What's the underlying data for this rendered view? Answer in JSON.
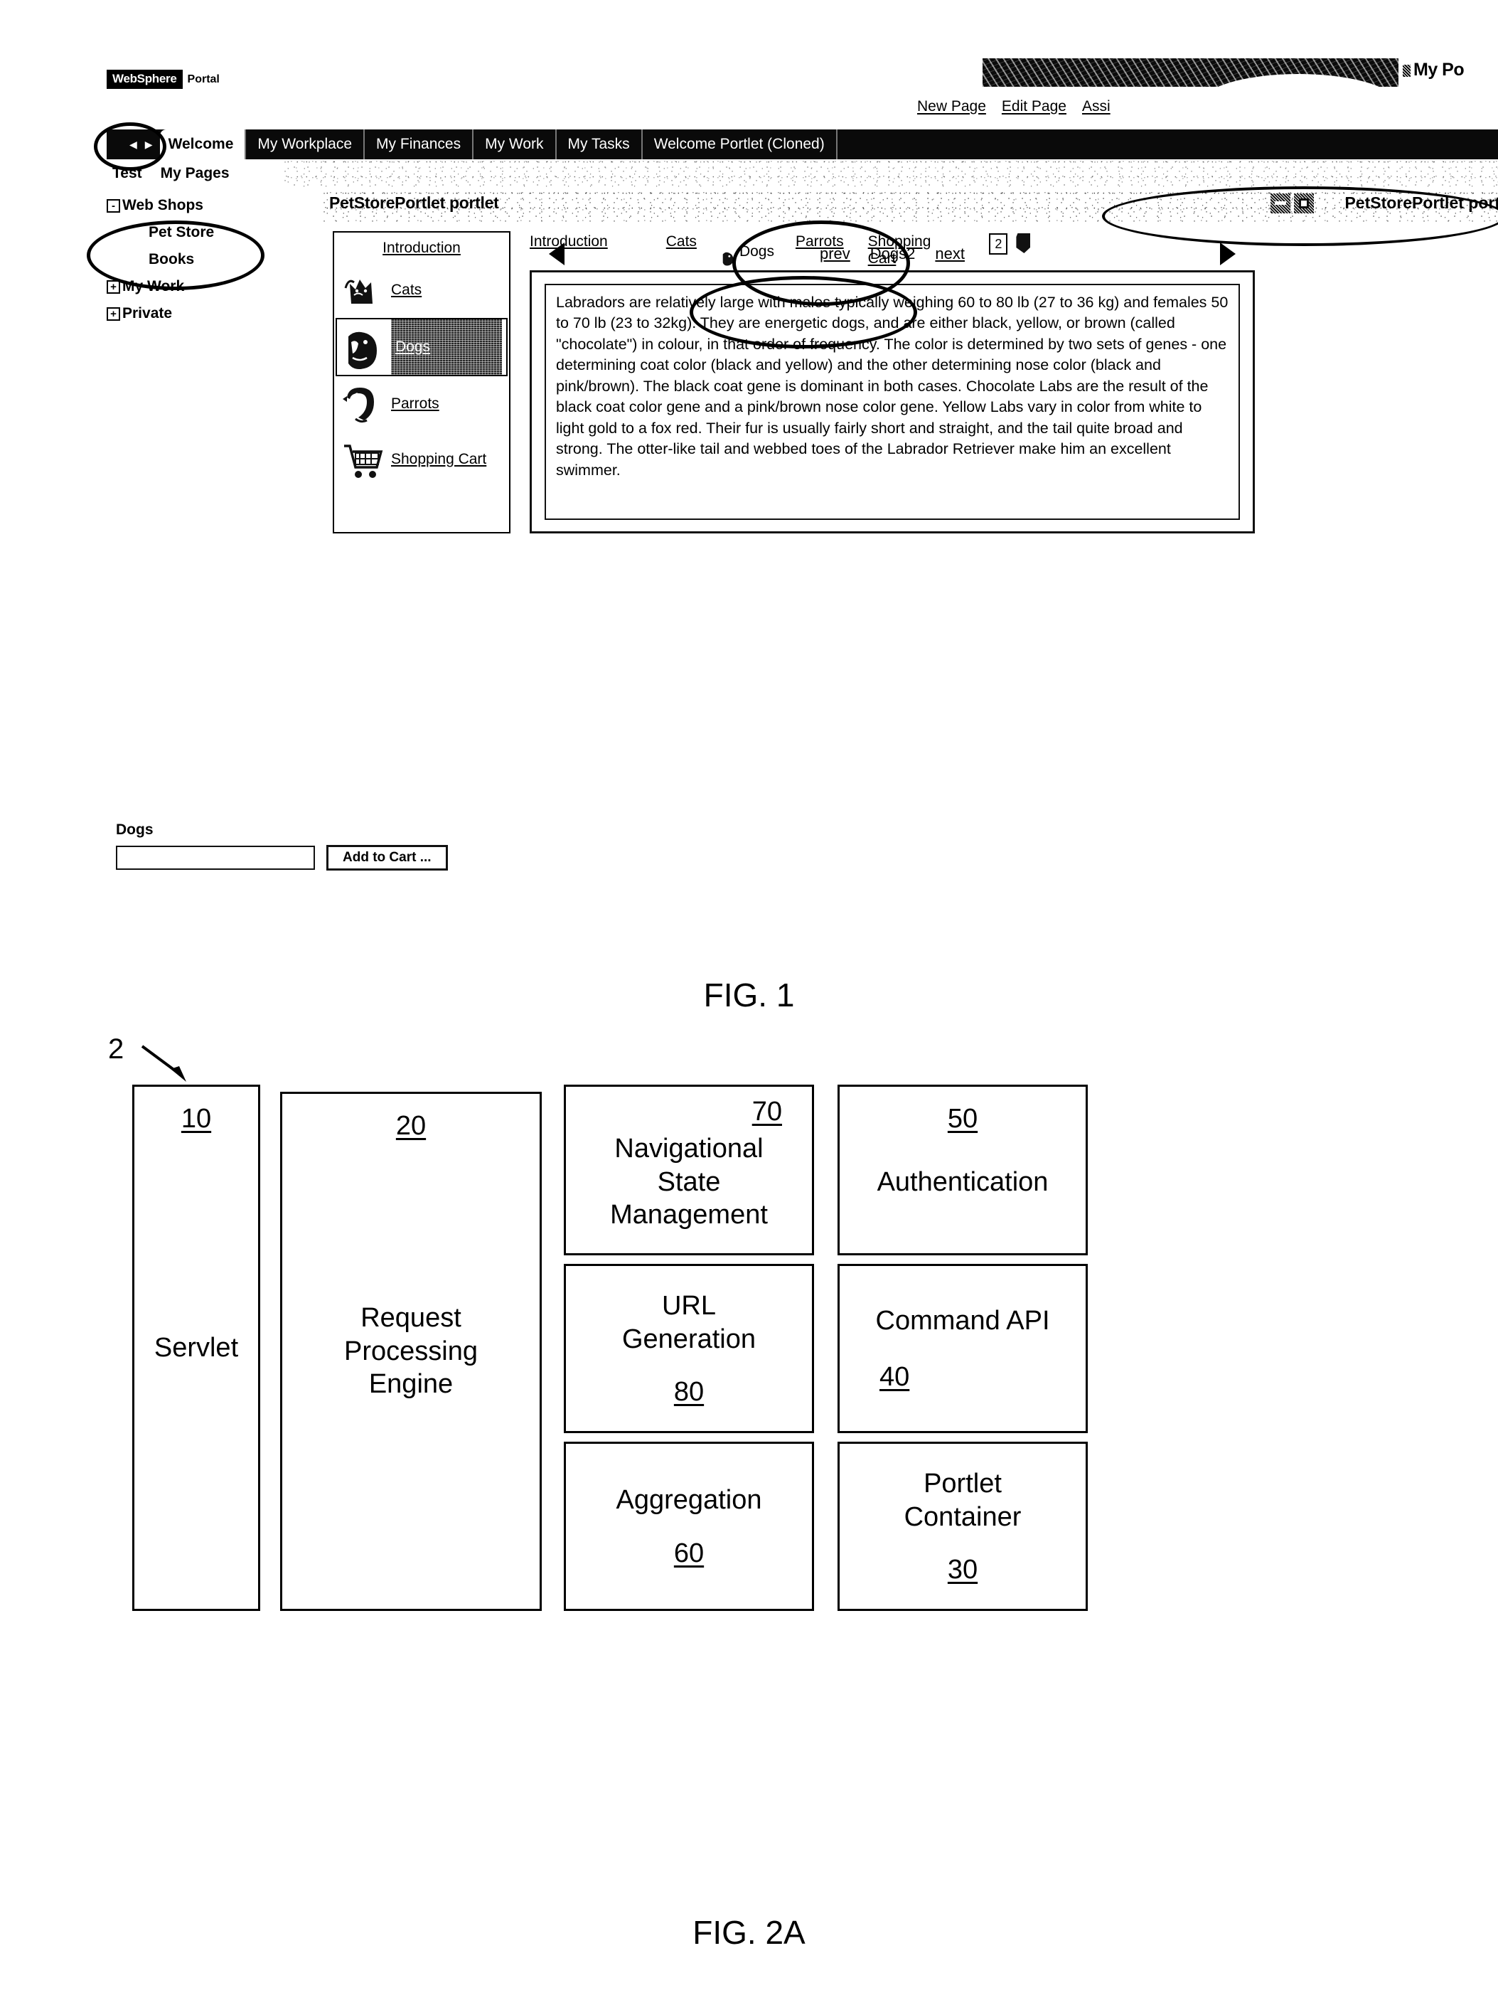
{
  "fig1": {
    "caption": "FIG. 1",
    "brand": {
      "logo_box": "WebSphere",
      "logo_word": "Portal"
    },
    "header": {
      "portal_title": "My Po",
      "page_actions": [
        "New Page",
        "Edit Page",
        "Assi"
      ]
    },
    "nav": {
      "tabs": [
        {
          "label": "Welcome",
          "active": true
        },
        {
          "label": "My Workplace",
          "active": false
        },
        {
          "label": "My Finances",
          "active": false
        },
        {
          "label": "My Work",
          "active": false
        },
        {
          "label": "My Tasks",
          "active": false
        },
        {
          "label": "Welcome Portlet (Cloned)",
          "active": false
        }
      ]
    },
    "subbar": {
      "items": [
        "Test",
        "My Pages"
      ]
    },
    "tree": [
      {
        "label": "Web Shops",
        "toggle": "-",
        "level": 0,
        "annotated": false
      },
      {
        "label": "Pet Store",
        "toggle": "",
        "level": 1,
        "annotated": true
      },
      {
        "label": "Books",
        "toggle": "",
        "level": 1,
        "annotated": false
      },
      {
        "label": "My Work",
        "toggle": "+",
        "level": 0,
        "annotated": false
      },
      {
        "label": "Private",
        "toggle": "+",
        "level": 0,
        "annotated": false
      }
    ],
    "portlet": {
      "title": "PetStorePortlet portlet",
      "title_right": "PetStorePortlet port",
      "icons": [
        "minimize-icon",
        "maximize-icon"
      ],
      "menu": {
        "heading": "Introduction",
        "items": [
          {
            "label": "Cats",
            "icon": "cat-icon",
            "selected": false
          },
          {
            "label": "Dogs",
            "icon": "dog-icon",
            "selected": true
          },
          {
            "label": "Parrots",
            "icon": "parrot-icon",
            "selected": false
          },
          {
            "label": "Shopping Cart",
            "icon": "shopping-cart-icon",
            "selected": false
          }
        ]
      },
      "tabs": [
        {
          "label": "Introduction",
          "active": false,
          "icon": ""
        },
        {
          "label": "Cats",
          "active": false,
          "icon": ""
        },
        {
          "label": "Dogs",
          "active": true,
          "icon": "dog-icon"
        },
        {
          "label": "Parrots",
          "active": false,
          "icon": ""
        },
        {
          "label": "Shopping\nCart",
          "active": false,
          "icon": ""
        }
      ],
      "count_badge": "2",
      "pager": {
        "prev": "prev",
        "current": "Dogs2",
        "next": "next"
      },
      "body_text": "Labradors are relatively large with males typically weighing 60 to 80 lb (27 to 36 kg) and females 50 to 70 lb (23 to 32kg). They are energetic dogs, and are either black, yellow, or brown (called \"chocolate\") in colour, in that order of frequency. The color is determined by two sets of genes - one determining coat color (black and yellow) and the other determining nose color (black and pink/brown). The black coat gene is dominant in both cases. Chocolate Labs are the result of the black coat color gene and a pink/brown nose color gene. Yellow Labs vary in color from white to light gold to a fox red. Their fur is usually fairly short and straight, and the tail quite broad and strong. The otter-like tail and webbed toes of the Labrador Retriever make him an excellent swimmer."
    },
    "cart": {
      "label": "Dogs",
      "input_value": "",
      "button": "Add to Cart ..."
    }
  },
  "fig2": {
    "caption": "FIG. 2A",
    "lead_number": "2",
    "boxes": [
      {
        "label": "Servlet",
        "number": "10",
        "num_pos": "top-center"
      },
      {
        "label": "Request\nProcessing\nEngine",
        "number": "20",
        "num_pos": "top-center"
      },
      {
        "label": "Navigational\nState\nManagement",
        "number": "70",
        "num_pos": "top-right"
      },
      {
        "label": "Authentication",
        "number": "50",
        "num_pos": "top-center"
      },
      {
        "label": "URL\nGeneration",
        "number": "80",
        "num_pos": "below-center"
      },
      {
        "label": "Command API",
        "number": "40",
        "num_pos": "below-left"
      },
      {
        "label": "Aggregation",
        "number": "60",
        "num_pos": "below-center"
      },
      {
        "label": "Portlet\nContainer",
        "number": "30",
        "num_pos": "below-center"
      }
    ]
  }
}
